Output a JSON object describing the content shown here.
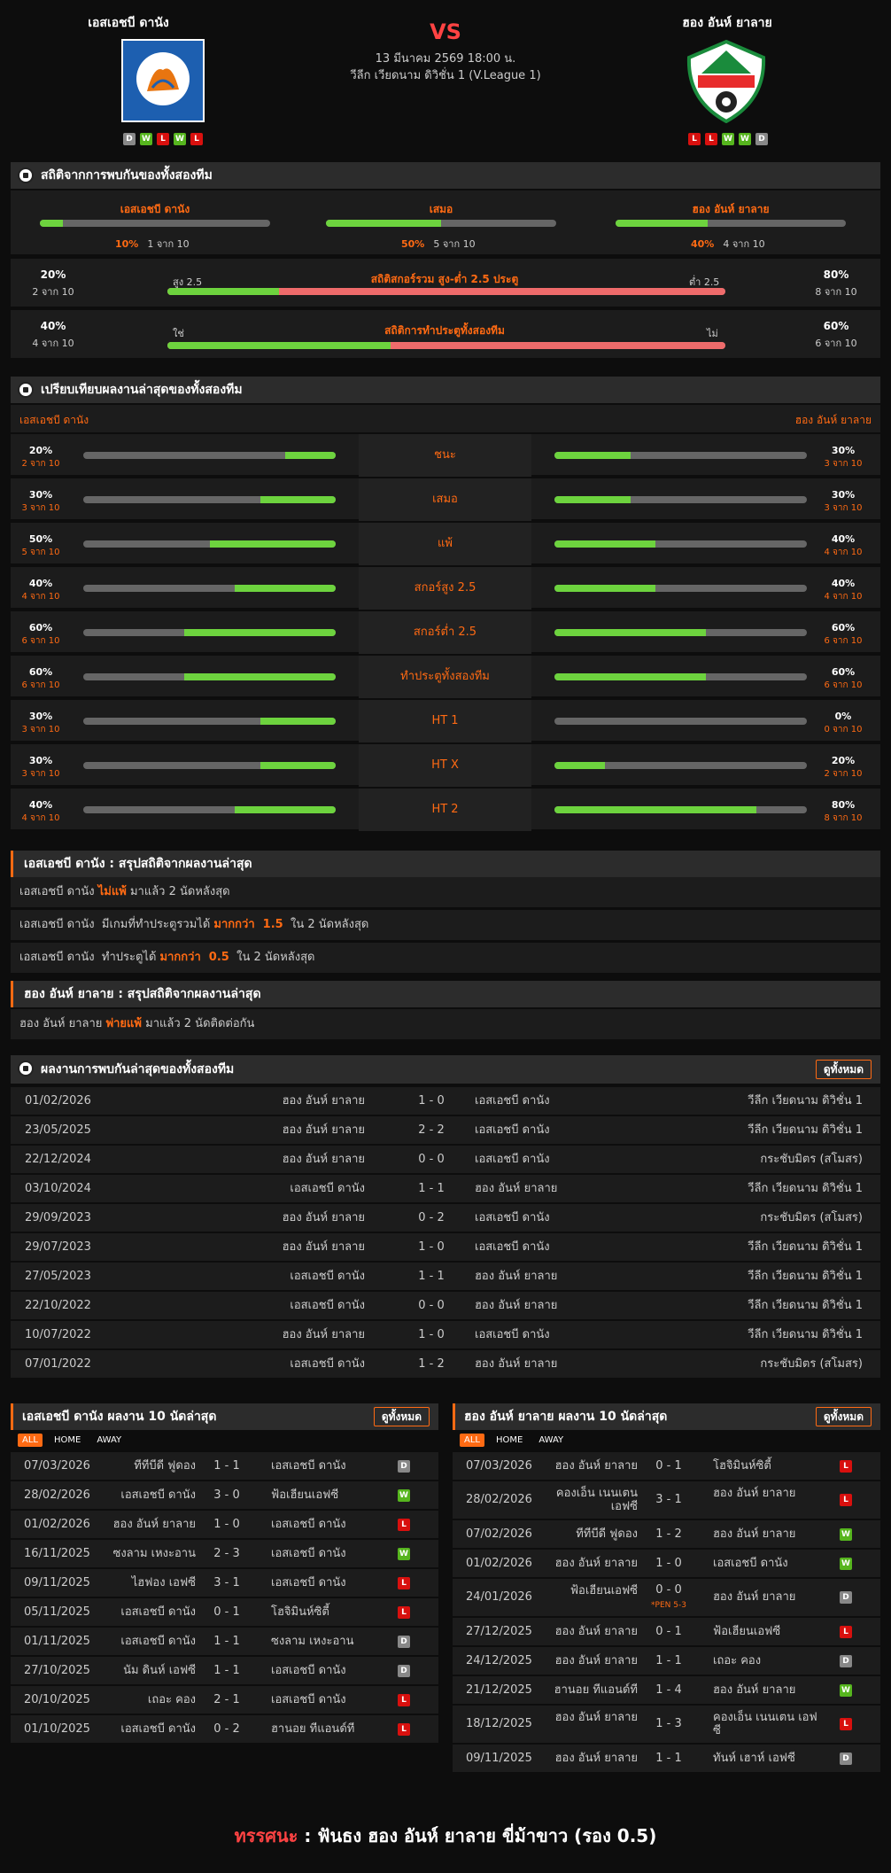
{
  "home": {
    "name": "เอสเอชบี ดานัง",
    "form": [
      "D",
      "W",
      "L",
      "W",
      "L"
    ]
  },
  "away": {
    "name": "ฮอง อันห์ ยาลาย",
    "form": [
      "L",
      "L",
      "W",
      "W",
      "D"
    ]
  },
  "match": {
    "vs": "VS",
    "date": "13 มีนาคม 2569 18:00 น.",
    "league": "วีลีก เวียดนาม ดิวิชั่น 1 (V.League 1)"
  },
  "h2h_stats": {
    "title": "สถิติจากการพบกันของทั้งสองทีม",
    "cols": [
      {
        "name": "เอสเอชบี ดานัง",
        "pct": "10%",
        "sub": "1 จาก 10",
        "value": 0.1
      },
      {
        "name": "เสมอ",
        "pct": "50%",
        "sub": "5 จาก 10",
        "value": 0.5
      },
      {
        "name": "ฮอง อันห์ ยาลาย",
        "pct": "40%",
        "sub": "4 จาก 10",
        "value": 0.4
      }
    ],
    "ou": {
      "title": "สถิติสกอร์รวม สูง-ต่ำ 2.5 ประตู",
      "left_pct": "20%",
      "left_sub": "2 จาก 10",
      "right_pct": "80%",
      "right_sub": "8 จาก 10",
      "left_label": "สูง 2.5",
      "right_label": "ต่ำ 2.5",
      "value": 0.2
    },
    "btts": {
      "title": "สถิติการทำประตูทั้งสองทีม",
      "left_pct": "40%",
      "left_sub": "4 จาก 10",
      "right_pct": "60%",
      "right_sub": "6 จาก 10",
      "left_label": "ใช่",
      "right_label": "ไม่",
      "value": 0.4
    }
  },
  "compare": {
    "title": "เปรียบเทียบผลงานล่าสุดของทั้งสองทีม",
    "home": "เอสเอชบี ดานัง",
    "away": "ฮอง อันห์ ยาลาย",
    "rows": [
      {
        "label": "ชนะ",
        "hp": "20%",
        "hs": "2 จาก 10",
        "hv": 0.2,
        "ap": "30%",
        "as": "3 จาก 10",
        "av": 0.3
      },
      {
        "label": "เสมอ",
        "hp": "30%",
        "hs": "3 จาก 10",
        "hv": 0.3,
        "ap": "30%",
        "as": "3 จาก 10",
        "av": 0.3
      },
      {
        "label": "แพ้",
        "hp": "50%",
        "hs": "5 จาก 10",
        "hv": 0.5,
        "ap": "40%",
        "as": "4 จาก 10",
        "av": 0.4
      },
      {
        "label": "สกอร์สูง 2.5",
        "hp": "40%",
        "hs": "4 จาก 10",
        "hv": 0.4,
        "ap": "40%",
        "as": "4 จาก 10",
        "av": 0.4
      },
      {
        "label": "สกอร์ต่ำ 2.5",
        "hp": "60%",
        "hs": "6 จาก 10",
        "hv": 0.6,
        "ap": "60%",
        "as": "6 จาก 10",
        "av": 0.6
      },
      {
        "label": "ทำประตูทั้งสองทีม",
        "hp": "60%",
        "hs": "6 จาก 10",
        "hv": 0.6,
        "ap": "60%",
        "as": "6 จาก 10",
        "av": 0.6
      },
      {
        "label": "HT 1",
        "hp": "30%",
        "hs": "3 จาก 10",
        "hv": 0.3,
        "ap": "0%",
        "as": "0 จาก 10",
        "av": 0.0
      },
      {
        "label": "HT X",
        "hp": "30%",
        "hs": "3 จาก 10",
        "hv": 0.3,
        "ap": "20%",
        "as": "2 จาก 10",
        "av": 0.2
      },
      {
        "label": "HT 2",
        "hp": "40%",
        "hs": "4 จาก 10",
        "hv": 0.4,
        "ap": "80%",
        "as": "8 จาก 10",
        "av": 0.8
      }
    ]
  },
  "summary_home": {
    "title": "เอสเอชบี ดานัง : สรุปสถิติจากผลงานล่าสุด",
    "rows": [
      [
        {
          "t": "เอสเอชบี ดานัง ",
          "o": false
        },
        {
          "t": "ไม่แพ้",
          "o": true
        },
        {
          "t": " มาแล้ว 2 นัดหลังสุด",
          "o": false
        }
      ],
      [
        {
          "t": "เอสเอชบี ดานัง  มีเกมที่ทำประตูรวมได้ ",
          "o": false
        },
        {
          "t": "มากกว่า  1.5",
          "o": true
        },
        {
          "t": "  ใน 2 นัดหลังสุด",
          "o": false
        }
      ],
      [
        {
          "t": "เอสเอชบี ดานัง  ทำประตูได้ ",
          "o": false
        },
        {
          "t": "มากกว่า  0.5",
          "o": true
        },
        {
          "t": "  ใน 2 นัดหลังสุด",
          "o": false
        }
      ]
    ]
  },
  "summary_away": {
    "title": "ฮอง อันห์ ยาลาย : สรุปสถิติจากผลงานล่าสุด",
    "rows": [
      [
        {
          "t": "ฮอง อันห์ ยาลาย ",
          "o": false
        },
        {
          "t": "พ่ายแพ้",
          "o": true
        },
        {
          "t": " มาแล้ว 2 นัดติดต่อกัน",
          "o": false
        }
      ]
    ]
  },
  "h2h_list": {
    "title": "ผลงานการพบกันล่าสุดของทั้งสองทีม",
    "view_all": "ดูทั้งหมด",
    "rows": [
      {
        "date": "01/02/2026",
        "home": "ฮอง อันห์ ยาลาย",
        "score": "1 - 0",
        "away": "เอสเอชบี ดานัง",
        "comp": "วีลีก เวียดนาม ดิวิชั่น 1"
      },
      {
        "date": "23/05/2025",
        "home": "ฮอง อันห์ ยาลาย",
        "score": "2 - 2",
        "away": "เอสเอชบี ดานัง",
        "comp": "วีลีก เวียดนาม ดิวิชั่น 1"
      },
      {
        "date": "22/12/2024",
        "home": "ฮอง อันห์ ยาลาย",
        "score": "0 - 0",
        "away": "เอสเอชบี ดานัง",
        "comp": "กระชับมิตร (สโมสร)"
      },
      {
        "date": "03/10/2024",
        "home": "เอสเอชบี ดานัง",
        "score": "1 - 1",
        "away": "ฮอง อันห์ ยาลาย",
        "comp": "วีลีก เวียดนาม ดิวิชั่น 1"
      },
      {
        "date": "29/09/2023",
        "home": "ฮอง อันห์ ยาลาย",
        "score": "0 - 2",
        "away": "เอสเอชบี ดานัง",
        "comp": "กระชับมิตร (สโมสร)"
      },
      {
        "date": "29/07/2023",
        "home": "ฮอง อันห์ ยาลาย",
        "score": "1 - 0",
        "away": "เอสเอชบี ดานัง",
        "comp": "วีลีก เวียดนาม ดิวิชั่น 1"
      },
      {
        "date": "27/05/2023",
        "home": "เอสเอชบี ดานัง",
        "score": "1 - 1",
        "away": "ฮอง อันห์ ยาลาย",
        "comp": "วีลีก เวียดนาม ดิวิชั่น 1"
      },
      {
        "date": "22/10/2022",
        "home": "เอสเอชบี ดานัง",
        "score": "0 - 0",
        "away": "ฮอง อันห์ ยาลาย",
        "comp": "วีลีก เวียดนาม ดิวิชั่น 1"
      },
      {
        "date": "10/07/2022",
        "home": "ฮอง อันห์ ยาลาย",
        "score": "1 - 0",
        "away": "เอสเอชบี ดานัง",
        "comp": "วีลีก เวียดนาม ดิวิชั่น 1"
      },
      {
        "date": "07/01/2022",
        "home": "เอสเอชบี ดานัง",
        "score": "1 - 2",
        "away": "ฮอง อันห์ ยาลาย",
        "comp": "กระชับมิตร (สโมสร)"
      }
    ]
  },
  "tabs": [
    "ALL",
    "HOME",
    "AWAY"
  ],
  "recent_home": {
    "title": "เอสเอชบี ดานัง ผลงาน 10 นัดล่าสุด",
    "view_all": "ดูทั้งหมด",
    "rows": [
      {
        "date": "07/03/2026",
        "home": "ทีทีบีดี ฟูดอง",
        "score": "1 - 1",
        "away": "เอสเอชบี ดานัง",
        "res": "D"
      },
      {
        "date": "28/02/2026",
        "home": "เอสเอชบี ดานัง",
        "score": "3 - 0",
        "away": "ฟ้อเฮียนเอฟซี",
        "res": "W"
      },
      {
        "date": "01/02/2026",
        "home": "ฮอง อันห์ ยาลาย",
        "score": "1 - 0",
        "away": "เอสเอชบี ดานัง",
        "res": "L"
      },
      {
        "date": "16/11/2025",
        "home": "ซงลาม เหงะอาน",
        "score": "2 - 3",
        "away": "เอสเอชบี ดานัง",
        "res": "W"
      },
      {
        "date": "09/11/2025",
        "home": "ไฮฟอง เอฟซี",
        "score": "3 - 1",
        "away": "เอสเอชบี ดานัง",
        "res": "L"
      },
      {
        "date": "05/11/2025",
        "home": "เอสเอชบี ดานัง",
        "score": "0 - 1",
        "away": "โฮจิมินห์ซิตี้",
        "res": "L"
      },
      {
        "date": "01/11/2025",
        "home": "เอสเอชบี ดานัง",
        "score": "1 - 1",
        "away": "ซงลาม เหงะอาน",
        "res": "D"
      },
      {
        "date": "27/10/2025",
        "home": "นัม ดินห์ เอฟซี",
        "score": "1 - 1",
        "away": "เอสเอชบี ดานัง",
        "res": "D"
      },
      {
        "date": "20/10/2025",
        "home": "เถอะ คอง",
        "score": "2 - 1",
        "away": "เอสเอชบี ดานัง",
        "res": "L"
      },
      {
        "date": "01/10/2025",
        "home": "เอสเอชบี ดานัง",
        "score": "0 - 2",
        "away": "ฮานอย ทีแอนด์ที",
        "res": "L"
      }
    ]
  },
  "recent_away": {
    "title": "ฮอง อันห์ ยาลาย ผลงาน 10 นัดล่าสุด",
    "view_all": "ดูทั้งหมด",
    "rows": [
      {
        "date": "07/03/2026",
        "home": "ฮอง อันห์ ยาลาย",
        "score": "0 - 1",
        "away": "โฮจิมินห์ซิตี้",
        "res": "L",
        "tall": false,
        "pen": ""
      },
      {
        "date": "28/02/2026",
        "home": "คองเอ็น เนนเตน เอฟซี",
        "score": "3 - 1",
        "away": "ฮอง อันห์ ยาลาย",
        "res": "L",
        "tall": true,
        "pen": ""
      },
      {
        "date": "07/02/2026",
        "home": "ทีทีบีดี ฟูดอง",
        "score": "1 - 2",
        "away": "ฮอง อันห์ ยาลาย",
        "res": "W",
        "tall": false,
        "pen": ""
      },
      {
        "date": "01/02/2026",
        "home": "ฮอง อันห์ ยาลาย",
        "score": "1 - 0",
        "away": "เอสเอชบี ดานัง",
        "res": "W",
        "tall": false,
        "pen": ""
      },
      {
        "date": "24/01/2026",
        "home": "ฟ้อเฮียนเอฟซี",
        "score": "0 - 0",
        "away": "ฮอง อันห์ ยาลาย",
        "res": "D",
        "tall": true,
        "pen": "*PEN 5-3"
      },
      {
        "date": "27/12/2025",
        "home": "ฮอง อันห์ ยาลาย",
        "score": "0 - 1",
        "away": "ฟ้อเฮียนเอฟซี",
        "res": "L",
        "tall": false,
        "pen": ""
      },
      {
        "date": "24/12/2025",
        "home": "ฮอง อันห์ ยาลาย",
        "score": "1 - 1",
        "away": "เถอะ คอง",
        "res": "D",
        "tall": false,
        "pen": ""
      },
      {
        "date": "21/12/2025",
        "home": "ฮานอย ทีแอนด์ที",
        "score": "1 - 4",
        "away": "ฮอง อันห์ ยาลาย",
        "res": "W",
        "tall": false,
        "pen": ""
      },
      {
        "date": "18/12/2025",
        "home": "ฮอง อันห์ ยาลาย",
        "score": "1 - 3",
        "away": "คองเอ็น เนนเตน เอฟซี",
        "res": "L",
        "tall": true,
        "pen": ""
      },
      {
        "date": "09/11/2025",
        "home": "ฮอง อันห์ ยาลาย",
        "score": "1 - 1",
        "away": "ทันห์ เฮาห์ เอฟซี",
        "res": "D",
        "tall": false,
        "pen": ""
      }
    ]
  },
  "verdict": {
    "label": "ทรรศนะ",
    "sep": " :  ",
    "text": "ฟันธง ฮอง อันห์ ยาลาย ขี่ม้าขาว (รอง 0.5)"
  },
  "colors": {
    "accent": "#ff6a13",
    "win": "#56b51e",
    "loss": "#d8100e",
    "draw": "#888888",
    "green_bar": "#6dd33e",
    "red_bar": "#ef6b6b",
    "vs": "#ff4343"
  }
}
